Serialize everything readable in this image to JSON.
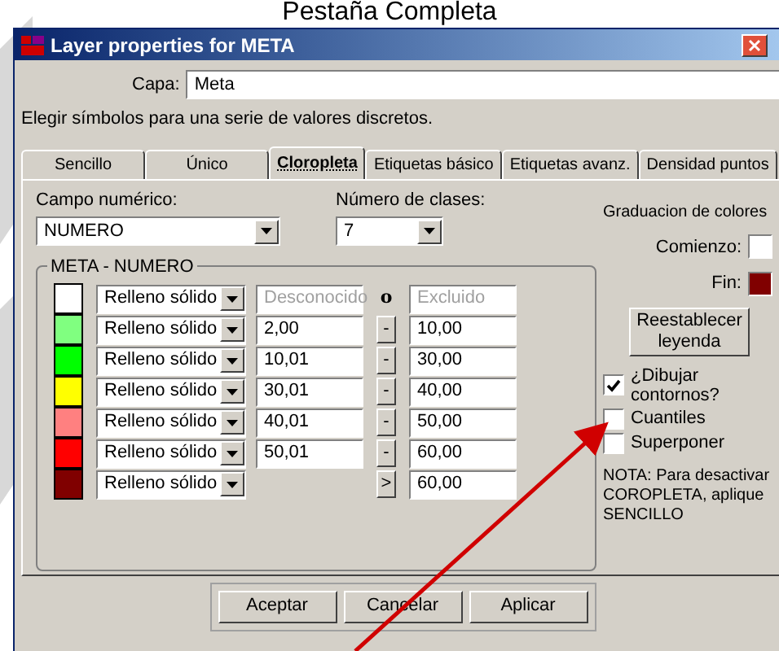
{
  "caption": "Pestaña Completa",
  "window": {
    "title": "Layer properties for META"
  },
  "layer": {
    "label": "Capa:",
    "value": "Meta"
  },
  "description": "Elegir símbolos para una serie de valores discretos.",
  "tabs": [
    {
      "label": "Sencillo",
      "selected": false
    },
    {
      "label": "Único",
      "selected": false
    },
    {
      "label": "Cloropleta",
      "selected": true
    },
    {
      "label": "Etiquetas básico",
      "selected": false
    },
    {
      "label": "Etiquetas avanz.",
      "selected": false
    },
    {
      "label": "Densidad puntos",
      "selected": false
    }
  ],
  "numeric_field": {
    "label": "Campo numérico:",
    "value": "NUMERO"
  },
  "classes": {
    "label": "Número de clases:",
    "value": "7"
  },
  "group": {
    "title": "META - NUMERO",
    "rows": [
      {
        "kind": "unknown",
        "color": "#ffffff",
        "fill": "Relleno sólido",
        "from": "Desconocido",
        "separator": "o",
        "to": "Excluido"
      },
      {
        "kind": "range",
        "color": "#80ff80",
        "fill": "Relleno sólido",
        "from": "2,00",
        "separator": "-",
        "to": "10,00"
      },
      {
        "kind": "range",
        "color": "#00ff00",
        "fill": "Relleno sólido",
        "from": "10,01",
        "separator": "-",
        "to": "30,00"
      },
      {
        "kind": "range",
        "color": "#ffff00",
        "fill": "Relleno sólido",
        "from": "30,01",
        "separator": "-",
        "to": "40,00"
      },
      {
        "kind": "range",
        "color": "#ff8080",
        "fill": "Relleno sólido",
        "from": "40,01",
        "separator": "-",
        "to": "50,00"
      },
      {
        "kind": "range",
        "color": "#ff0000",
        "fill": "Relleno sólido",
        "from": "50,01",
        "separator": "-",
        "to": "60,00"
      },
      {
        "kind": "above",
        "color": "#800000",
        "fill": "Relleno sólido",
        "separator": ">",
        "to": "60,00"
      }
    ]
  },
  "gradient": {
    "title": "Graduacion de colores",
    "start": {
      "label": "Comienzo:",
      "color": "#ffffff"
    },
    "end": {
      "label": "Fin:",
      "color": "#800000"
    },
    "reset": "Reestablecer leyenda"
  },
  "checkboxes": [
    {
      "label": "¿Dibujar contornos?",
      "checked": true
    },
    {
      "label": "Cuantiles",
      "checked": false
    },
    {
      "label": "Superponer",
      "checked": false
    }
  ],
  "note": "NOTA: Para desactivar COROPLETA, aplique SENCILLO",
  "buttons": [
    "Aceptar",
    "Cancelar",
    "Aplicar"
  ]
}
